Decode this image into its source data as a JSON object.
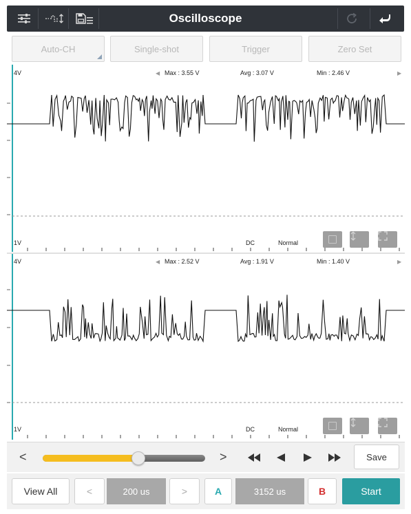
{
  "app": {
    "title": "Oscilloscope",
    "icons": {
      "settings": "sliders-icon",
      "signal": "signal-adjust-icon",
      "save_menu": "save-list-icon",
      "refresh": "refresh-icon",
      "back": "back-arrow-icon"
    }
  },
  "modes": [
    {
      "label": "Auto-CH"
    },
    {
      "label": "Single-shot"
    },
    {
      "label": "Trigger"
    },
    {
      "label": "Zero Set"
    }
  ],
  "channel1": {
    "top_label": "4V",
    "bottom_label": "1V",
    "max": "Max : 3.55 V",
    "avg": "Avg : 3.07 V",
    "min": "Min : 2.46 V",
    "coupling": "DC",
    "mode": "Normal"
  },
  "channel2": {
    "top_label": "4V",
    "bottom_label": "1V",
    "max": "Max : 2.52 V",
    "avg": "Avg : 1.91 V",
    "min": "Min : 1.40 V",
    "coupling": "DC",
    "mode": "Normal"
  },
  "timeline": {
    "prev": "<",
    "next": ">",
    "position": 0.59,
    "save_label": "Save"
  },
  "controls": {
    "view_all": "View All",
    "time_prev": "<",
    "time_div": "200 us",
    "time_next": ">",
    "cursor_a": "A",
    "cursor_delta": "3152 us",
    "cursor_b": "B",
    "start": "Start"
  },
  "colors": {
    "titlebar": "#2f3339",
    "accent": "#2a9da0",
    "slider": "#f5bd1f",
    "cursor_a": "#2aaab0",
    "cursor_b": "#d32f2f",
    "trace": "#111111"
  }
}
